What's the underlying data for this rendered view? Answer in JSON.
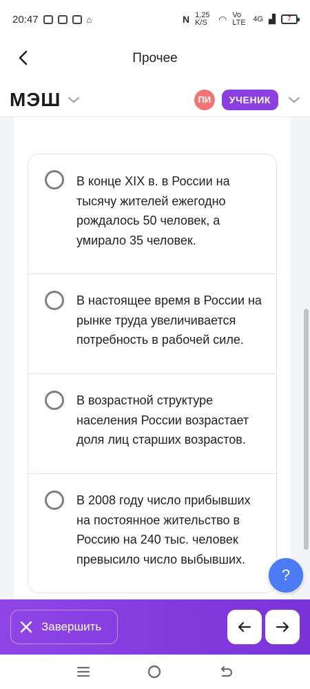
{
  "status_bar": {
    "time": "20:47",
    "network_speed": "1,25 K/S",
    "volte": "Vo LTE",
    "network_type": "4G",
    "battery_level": "7"
  },
  "header": {
    "title": "Прочее"
  },
  "brand": {
    "logo": "МЭШ",
    "avatar_initials": "ПИ",
    "role": "УЧЕНИК"
  },
  "answers": [
    {
      "text": "В  конце XIX в. в России на тысячу жителей ежегодно рождалось 50 человек, а умирало 35 человек.",
      "selected": false
    },
    {
      "text": "В настоящее время в России на рынке труда увеличивается потребность в рабочей силе.",
      "selected": false
    },
    {
      "text": "В возрастной структуре населения России возрастает доля лиц старших возрастов.",
      "selected": false
    },
    {
      "text": "В 2008 году число прибывших на постоянное жительство в Россию на 240 тыс. человек превысило число выбывших.",
      "selected": false
    }
  ],
  "help": {
    "label": "?"
  },
  "actions": {
    "finish_label": "Завершить"
  },
  "colors": {
    "accent_purple": "#8b3fe0",
    "avatar_red": "#f27575",
    "help_blue": "#4b7cf3"
  }
}
